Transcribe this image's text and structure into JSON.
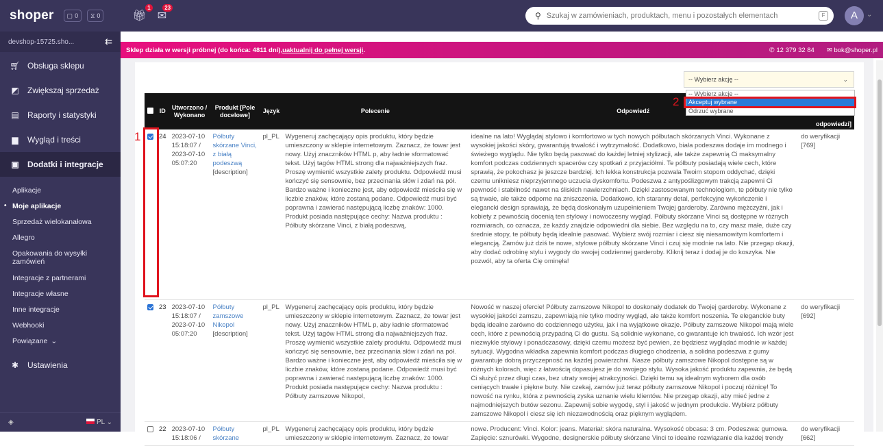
{
  "topbar": {
    "logo": "shoper",
    "chip1": "0",
    "chip2": "0",
    "gift_badge": "1",
    "mail_badge": "23",
    "search_placeholder": "Szukaj w zamówieniach, produktach, menu i pozostałych elementach",
    "avatar": "A"
  },
  "sidebar": {
    "shop": "devshop-15725.sho...",
    "items": [
      {
        "label": "Obsługa sklepu",
        "icon": "cart-icon"
      },
      {
        "label": "Zwiększaj sprzedaż",
        "icon": "chart-icon"
      },
      {
        "label": "Raporty i statystyki",
        "icon": "report-icon"
      },
      {
        "label": "Wygląd i treści",
        "icon": "layout-icon"
      },
      {
        "label": "Dodatki i integracje",
        "icon": "addons-icon"
      }
    ],
    "sub": [
      "Aplikacje",
      "Moje aplikacje",
      "Sprzedaż wielokanałowa",
      "Allegro",
      "Opakowania do wysyłki zamówień",
      "Integracje z partnerami",
      "Integracje własne",
      "Inne integracje",
      "Webhooki",
      "Powiązane"
    ],
    "settings": "Ustawienia",
    "lang": "PL"
  },
  "banner": {
    "text": "Sklep działa w wersji próbnej (do końca: 4811 dni), ",
    "link": "uaktualnij do pełnej wersji",
    "end": ".",
    "phone": "12 379 32 84",
    "email": "bok@shoper.pl"
  },
  "action": {
    "select_value": "-- Wybierz akcję --",
    "options": [
      "-- Wybierz akcje --",
      "Akceptuj wybrane",
      "Odrzuć wybrane"
    ]
  },
  "annot": {
    "one": "1",
    "two": "2"
  },
  "table": {
    "headers": [
      "ID",
      "Utworzono / Wykonano",
      "Produkt [Pole docelowe]",
      "Język",
      "Polecenie",
      "Odpowiedź",
      "odpowiedzi]"
    ],
    "rows": [
      {
        "checked": true,
        "id": "24",
        "created": "2023-07-10 15:18:07 / 2023-07-10 05:07:20",
        "product": "Półbuty skórzane Vinci, z białą podeszwą",
        "field": "[description]",
        "lang": "pl_PL",
        "prompt": "Wygeneruj zachęcający opis produktu, który będzie umieszczony w sklepie internetowym. Zaznacz, że towar jest nowy. Użyj znaczników HTML p, aby ładnie sformatować tekst. Użyj tagów HTML strong dla najważniejszych fraz. Proszę wymienić wszystkie zalety produktu. Odpowiedź musi kończyć się sensownie, bez przecinania słów i zdań na pół. Bardzo ważne i konieczne jest, aby odpowiedź mieściła się w liczbie znaków, które zostaną podane. Odpowiedź musi być poprawna i zawierać następującą liczbę znaków: 1000. Produkt posiada następujące cechy: Nazwa produktu : Półbuty skórzane Vinci, z białą podeszwą,",
        "answer": "idealne na lato! Wyglądaj stylowo i komfortowo w tych nowych półbutach skórzanych Vinci. Wykonane z wysokiej jakości skóry, gwarantują trwałość i wytrzymałość. Dodatkowo, biała podeszwa dodaje im modnego i świeżego wyglądu. Nie tylko będą pasować do każdej letniej stylizacji, ale także zapewnią Ci maksymalny komfort podczas codziennych spacerów czy spotkań z przyjaciółmi. Te półbuty posiadają wiele cech, które sprawią, że pokochasz je jeszcze bardziej. Ich lekka konstrukcja pozwala Twoim stopom oddychać, dzięki czemu unikniesz nieprzyjemnego uczucia dyskomfortu. Podeszwa z antypoślizgowym trakcją zapewni Ci pewność i stabilność nawet na śliskich nawierzchniach. Dzięki zastosowanym technologiom, te półbuty nie tylko są trwałe, ale także odporne na zniszczenia. Dodatkowo, ich staranny detal, perfekcyjne wykończenie i elegancki design sprawiają, że będą doskonałym uzupełnieniem Twojej garderoby. Zarówno mężczyźni, jak i kobiety z pewnością docenią ten stylowy i nowoczesny wygląd. Półbuty skórzane Vinci są dostępne w różnych rozmiarach, co oznacza, że każdy znajdzie odpowiedni dla siebie. Bez względu na to, czy masz małe, duże czy średnie stopy, te półbuty będą idealnie pasować. Wybierz swój rozmiar i ciesz się niesamowitym komfortem i elegancją. Zamów już dziś te nowe, stylowe półbuty skórzane Vinci i czuj się modnie na lato. Nie przegap okazji, aby dodać odrobinę stylu i wygody do swojej codziennej garderoby. Kliknij teraz i dodaj je do koszyka. Nie pozwól, aby ta oferta Cię ominęła!",
        "status": "do weryfikacji [769]"
      },
      {
        "checked": true,
        "id": "23",
        "created": "2023-07-10 15:18:07 / 2023-07-10 05:07:20",
        "product": "Półbuty zamszowe Nikopol",
        "field": "[description]",
        "lang": "pl_PL",
        "prompt": "Wygeneruj zachęcający opis produktu, który będzie umieszczony w sklepie internetowym. Zaznacz, że towar jest nowy. Użyj znaczników HTML p, aby ładnie sformatować tekst. Użyj tagów HTML strong dla najważniejszych fraz. Proszę wymienić wszystkie zalety produktu. Odpowiedź musi kończyć się sensownie, bez przecinania słów i zdań na pół. Bardzo ważne i konieczne jest, aby odpowiedź mieściła się w liczbie znaków, które zostaną podane. Odpowiedź musi być poprawna i zawierać następującą liczbę znaków: 1000. Produkt posiada następujące cechy: Nazwa produktu : Półbuty zamszowe Nikopol,",
        "answer": "Nowość w naszej ofercie! Półbuty zamszowe Nikopol to doskonały dodatek do Twojej garderoby. Wykonane z wysokiej jakości zamszu, zapewniają nie tylko modny wygląd, ale także komfort noszenia. Te eleganckie buty będą idealne zarówno do codziennego użytku, jak i na wyjątkowe okazje. Półbuty zamszowe Nikopol mają wiele cech, które z pewnością przypadną Ci do gustu. Są solidnie wykonane, co gwarantuje ich trwałość. Ich wzór jest niezwykle stylowy i ponadczasowy, dzięki czemu możesz być pewien, że będziesz wyglądać modnie w każdej sytuacji. Wygodna wkładka zapewnia komfort podczas długiego chodzenia, a solidna podeszwa z gumy gwarantuje dobrą przyczepność na każdej powierzchni. Nasze półbuty zamszowe Nikopol dostępne są w różnych kolorach, więc z łatwością dopasujesz je do swojego stylu. Wysoka jakość produktu zapewnia, że będą Ci służyć przez długi czas, bez utraty swojej atrakcyjności. Dzięki temu są idealnym wyborem dla osób ceniących trwałe i piękne buty. Nie czekaj, zamów już teraz półbuty zamszowe Nikopol i poczuj różnicę! To nowość na rynku, która z pewnością zyska uznanie wielu klientów. Nie przegap okazji, aby mieć jedne z najmodniejszych butów sezonu. Zapewnij sobie wygodę, styl i jakość w jednym produkcie. Wybierz półbuty zamszowe Nikopol i ciesz się ich niezawodnością oraz pięknym wyglądem.",
        "status": "do weryfikacji [692]"
      },
      {
        "checked": false,
        "id": "22",
        "created": "2023-07-10 15:18:06 /",
        "product": "Półbuty skórzane",
        "field": "",
        "lang": "pl_PL",
        "prompt": "Wygeneruj zachęcający opis produktu, który będzie umieszczony w sklepie internetowym. Zaznacz, że towar",
        "answer": "nowe. Producent: Vinci. Kolor: jeans. Materiał: skóra naturalna. Wysokość obcasa: 3 cm. Podeszwa: gumowa. Zapięcie: sznurówki. Wygodne, designerskie półbuty skórzane Vinci to idealne rozwiązanie dla każdej trendy",
        "status": "do weryfikacji [662]"
      }
    ]
  }
}
